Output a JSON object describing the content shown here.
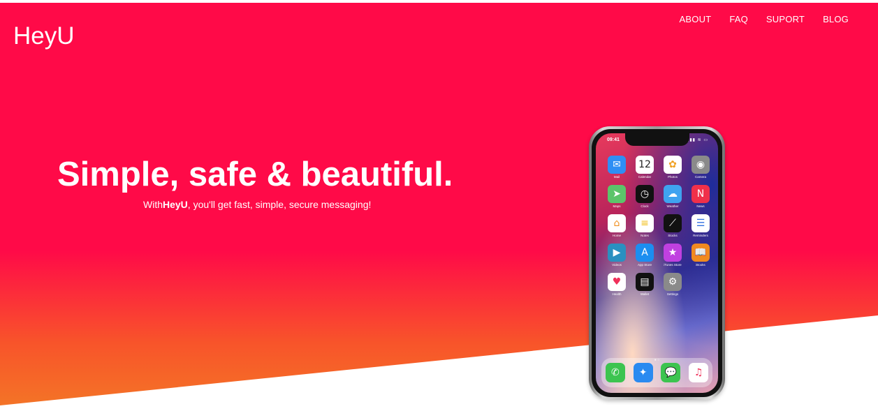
{
  "brand": {
    "logo": "HeyU"
  },
  "nav": [
    {
      "label": "ABOUT"
    },
    {
      "label": "FAQ"
    },
    {
      "label": "SUPORT"
    },
    {
      "label": "BLOG"
    }
  ],
  "hero": {
    "headline": "Simple, safe & beautiful.",
    "tagline_prefix": "With",
    "tagline_brand": "HeyU",
    "tagline_rest": ", you'll get fast, simple, secure messaging!"
  },
  "colors": {
    "hero_top": "#ff0a48",
    "hero_bottom": "#f37a26",
    "text": "#ffffff"
  },
  "phone": {
    "time": "09:41",
    "status_icons": "▮▮▮ ≋ ▭",
    "apps": [
      {
        "label": "Mail",
        "icon": "mail-icon",
        "glyph": "✉",
        "color": "#2f8ef4"
      },
      {
        "label": "Calendar",
        "icon": "calendar-icon",
        "glyph": "12",
        "color": "#ffffff",
        "fg": "#222222"
      },
      {
        "label": "Photos",
        "icon": "photos-icon",
        "glyph": "✿",
        "color": "#ffffff",
        "fg": "#f0a020"
      },
      {
        "label": "Camera",
        "icon": "camera-icon",
        "glyph": "◉",
        "color": "#8a8a8a"
      },
      {
        "label": "Maps",
        "icon": "maps-icon",
        "glyph": "➤",
        "color": "#5cc46a"
      },
      {
        "label": "Clock",
        "icon": "clock-icon",
        "glyph": "◷",
        "color": "#111111"
      },
      {
        "label": "Weather",
        "icon": "weather-icon",
        "glyph": "☁",
        "color": "#3fa3f0"
      },
      {
        "label": "News",
        "icon": "news-icon",
        "glyph": "N",
        "color": "#f0304a"
      },
      {
        "label": "Home",
        "icon": "home-icon",
        "glyph": "⌂",
        "color": "#ffffff",
        "fg": "#f09020"
      },
      {
        "label": "Notes",
        "icon": "notes-icon",
        "glyph": "≡",
        "color": "#ffffff",
        "fg": "#f0c020"
      },
      {
        "label": "Stocks",
        "icon": "stocks-icon",
        "glyph": "⟋",
        "color": "#111111"
      },
      {
        "label": "Reminders",
        "icon": "reminders-icon",
        "glyph": "☰",
        "color": "#ffffff",
        "fg": "#3070e0"
      },
      {
        "label": "Videos",
        "icon": "videos-icon",
        "glyph": "▶",
        "color": "#2a90c0"
      },
      {
        "label": "App Store",
        "icon": "app-store-icon",
        "glyph": "A",
        "color": "#1c8ef0"
      },
      {
        "label": "iTunes Store",
        "icon": "itunes-store-icon",
        "glyph": "★",
        "color": "#c040e0"
      },
      {
        "label": "iBooks",
        "icon": "ibooks-icon",
        "glyph": "📖",
        "color": "#f08a20"
      },
      {
        "label": "Health",
        "icon": "health-icon",
        "glyph": "♥",
        "color": "#ffffff",
        "fg": "#f0305a"
      },
      {
        "label": "Wallet",
        "icon": "wallet-icon",
        "glyph": "▤",
        "color": "#111111"
      },
      {
        "label": "Settings",
        "icon": "settings-icon",
        "glyph": "⚙",
        "color": "#8a8a8a"
      }
    ],
    "dock": [
      {
        "icon": "phone-icon",
        "glyph": "✆",
        "color": "#3cc450"
      },
      {
        "icon": "safari-icon",
        "glyph": "✦",
        "color": "#2a8af0"
      },
      {
        "icon": "messages-icon",
        "glyph": "💬",
        "color": "#3cc450"
      },
      {
        "icon": "music-icon",
        "glyph": "♫",
        "color": "#ffffff",
        "fg": "#f0305a"
      }
    ]
  }
}
